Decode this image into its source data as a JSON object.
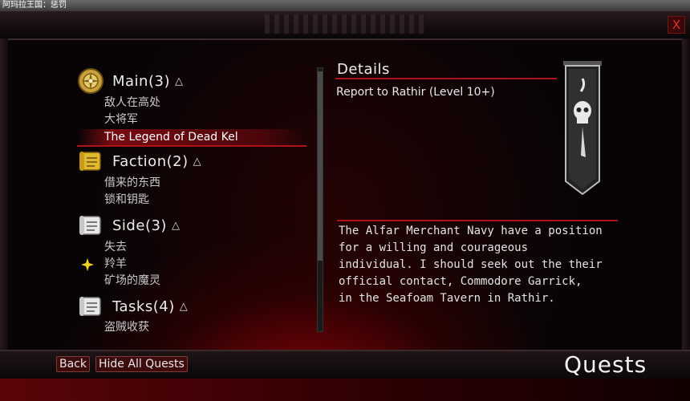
{
  "window": {
    "title": "阿玛拉王国：惩罚",
    "close_label": "X"
  },
  "categories": [
    {
      "label": "Main",
      "count": "(3)",
      "arrow": "△",
      "icon": "compass-medallion-icon",
      "quests": [
        "敌人在高处",
        "大将军",
        "The Legend of Dead Kel"
      ]
    },
    {
      "label": "Faction",
      "count": "(2)",
      "arrow": "△",
      "icon": "gold-scroll-icon",
      "quests": [
        "借来的东西",
        "锁和钥匙"
      ]
    },
    {
      "label": "Side",
      "count": "(3)",
      "arrow": "△",
      "icon": "paper-scroll-icon",
      "quests": [
        "失去",
        "羚羊",
        "矿场的魔灵"
      ]
    },
    {
      "label": "Tasks",
      "count": "(4)",
      "arrow": "△",
      "icon": "paper-scroll-icon",
      "quests": [
        "盗贼收获"
      ]
    }
  ],
  "selected_quest": "The Legend of Dead Kel",
  "tracked_marker_icon": "yellow-cross-marker-icon",
  "details": {
    "header": "Details",
    "subtitle": "Report to Rathir (Level 10+)",
    "banner_icon": "skull-banner-icon",
    "description": "The Alfar Merchant Navy have a position\nfor a willing and courageous\nindividual. I should seek out the their\nofficial contact, Commodore Garrick,\nin the Seafoam Tavern in Rathir."
  },
  "buttons": {
    "back": "Back",
    "hide_all": "Hide All Quests"
  },
  "screen_title": "Quests",
  "colors": {
    "accent_red": "#b0121a",
    "text": "#e4e4e4",
    "marker": "#f0d020"
  }
}
